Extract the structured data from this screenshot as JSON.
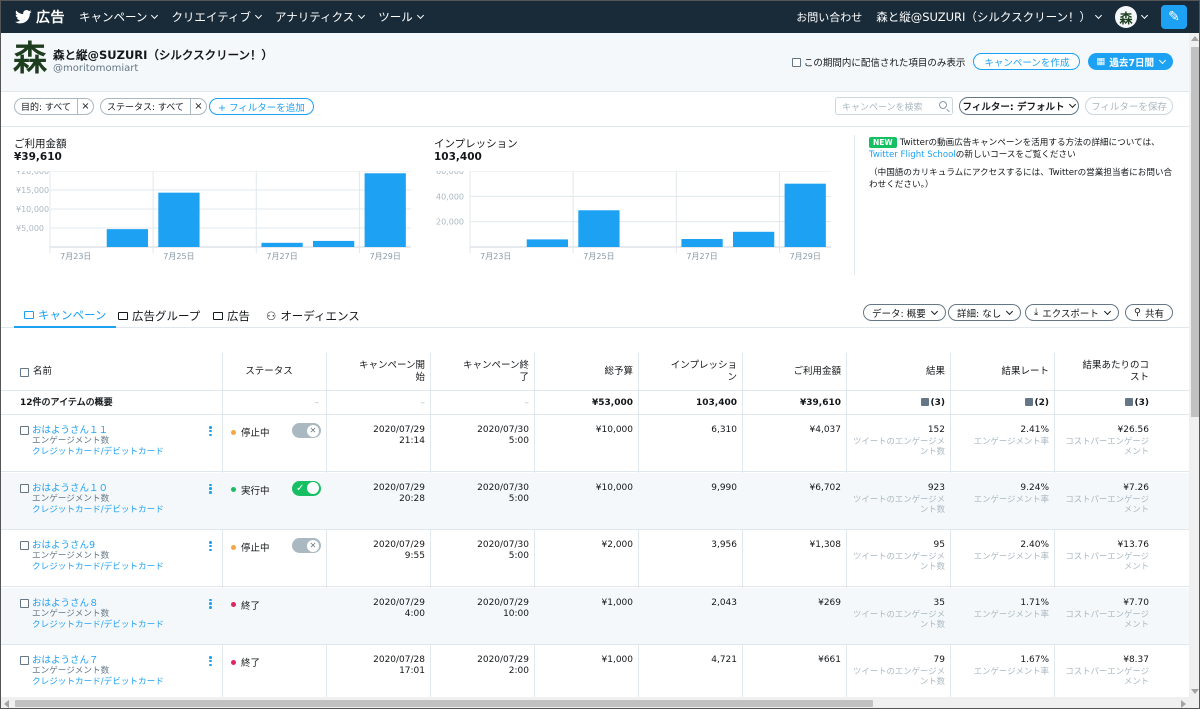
{
  "nav": {
    "brand": "広告",
    "menu": [
      "キャンペーン",
      "クリエイティブ",
      "アナリティクス",
      "ツール"
    ],
    "contact": "お問い合わせ",
    "account_menu": "森と縦@SUZURI（シルクスクリーン！）",
    "avatar_char": "森"
  },
  "account": {
    "logo_char": "森",
    "name": "森と縦@SUZURI（シルクスクリーン！）",
    "handle": "@moritomomiart",
    "only_delivered_label": "この期間内に配信された項目のみ表示",
    "create_campaign": "キャンペーンを作成",
    "date_range": "過去7日間"
  },
  "filters": {
    "chips": [
      "目的: すべて",
      "ステータス: すべて"
    ],
    "add_filter": "+ フィルターを追加",
    "search_placeholder": "キャンペーンを検索",
    "filter_default": "フィルター: デフォルト",
    "save_filter": "フィルターを保存"
  },
  "summary": {
    "spend_label": "ご利用金額",
    "spend_value": "¥39,610",
    "impressions_label": "インプレッション",
    "impressions_value": "103,400",
    "promo_badge": "NEW",
    "promo_text": "Twitterの動画広告キャンペーンを活用する方法の詳細については、",
    "promo_link": "Twitter Flight School",
    "promo_text_end": "の新しいコースをご覧ください",
    "promo_text2": "（中国語のカリキュラムにアクセスするには、Twitterの営業担当者にお問い合わせください。）"
  },
  "chart_data": [
    {
      "type": "bar",
      "title": "ご利用金額",
      "x": [
        "7月23日",
        "7月24日",
        "7月25日",
        "7月26日",
        "7月27日",
        "7月28日",
        "7月29日"
      ],
      "x_tick_labels": [
        "7月23日",
        "7月25日",
        "7月27日",
        "7月29日"
      ],
      "values": [
        0,
        4700,
        14300,
        0,
        1100,
        1600,
        19400
      ],
      "y_ticks": [
        "¥5,000",
        "¥10,000",
        "¥15,000",
        "¥20,000"
      ],
      "y_tick_values": [
        5000,
        10000,
        15000,
        20000
      ],
      "ylim": [
        0,
        20000
      ],
      "color": "#1da1f2",
      "grid": true
    },
    {
      "type": "bar",
      "title": "インプレッション",
      "x": [
        "7月23日",
        "7月24日",
        "7月25日",
        "7月26日",
        "7月27日",
        "7月28日",
        "7月29日"
      ],
      "x_tick_labels": [
        "7月23日",
        "7月25日",
        "7月27日",
        "7月29日"
      ],
      "values": [
        0,
        6000,
        29000,
        0,
        6300,
        12000,
        50000
      ],
      "y_ticks": [
        "20,000",
        "40,000",
        "60,000"
      ],
      "y_tick_values": [
        20000,
        40000,
        60000
      ],
      "ylim": [
        0,
        60000
      ],
      "color": "#1da1f2",
      "grid": true
    }
  ],
  "tabs": {
    "items": [
      "キャンペーン",
      "広告グループ",
      "広告",
      "オーディエンス"
    ],
    "data_btn": "データ: 概要",
    "detail_btn": "詳細: なし",
    "export_btn": "エクスポート",
    "share_btn": "共有"
  },
  "table": {
    "headers": {
      "name": "名前",
      "status": "ステータス",
      "start": "キャンペーン開始",
      "end": "キャンペーン終了",
      "budget": "総予算",
      "impressions": "インプレッション",
      "spend": "ご利用金額",
      "results": "結果",
      "result_rate": "結果レート",
      "cost_per_result": "結果あたりのコスト"
    },
    "summary": {
      "label": "12件のアイテムの概要",
      "status": "–",
      "start": "–",
      "end": "–",
      "budget": "¥53,000",
      "impressions": "103,400",
      "spend": "¥39,610",
      "results": "(3)",
      "result_rate": "(2)",
      "cost_per_result": "(3)"
    },
    "rows": [
      {
        "name": "おはようさん１１",
        "type": "エンゲージメント数",
        "payment": "クレジットカード/デビットカード",
        "status": "停止中",
        "status_color": "#f4a742",
        "toggle": "off",
        "start_date": "2020/07/29",
        "start_time": "21:14",
        "end_date": "2020/07/30",
        "end_time": "5:00",
        "budget": "¥10,000",
        "impressions": "6,310",
        "spend": "¥4,037",
        "results": "152",
        "results_sub": "ツイートのエンゲージメント数",
        "rate": "2.41%",
        "rate_sub": "エンゲージメント率",
        "cost": "¥26.56",
        "cost_sub": "コストパーエンゲージメント"
      },
      {
        "name": "おはようさん１０",
        "type": "エンゲージメント数",
        "payment": "クレジットカード/デビットカード",
        "status": "実行中",
        "status_color": "#17bf63",
        "toggle": "on",
        "start_date": "2020/07/29",
        "start_time": "20:28",
        "end_date": "2020/07/30",
        "end_time": "5:00",
        "budget": "¥10,000",
        "impressions": "9,990",
        "spend": "¥6,702",
        "results": "923",
        "results_sub": "ツイートのエンゲージメント数",
        "rate": "9.24%",
        "rate_sub": "エンゲージメント率",
        "cost": "¥7.26",
        "cost_sub": "コストパーエンゲージメント"
      },
      {
        "name": "おはようさん9",
        "type": "エンゲージメント数",
        "payment": "クレジットカード/デビットカード",
        "status": "停止中",
        "status_color": "#f4a742",
        "toggle": "off",
        "start_date": "2020/07/29",
        "start_time": "9:55",
        "end_date": "2020/07/30",
        "end_time": "5:00",
        "budget": "¥2,000",
        "impressions": "3,956",
        "spend": "¥1,308",
        "results": "95",
        "results_sub": "ツイートのエンゲージメント数",
        "rate": "2.40%",
        "rate_sub": "エンゲージメント率",
        "cost": "¥13.76",
        "cost_sub": "コストパーエンゲージメント"
      },
      {
        "name": "おはようさん８",
        "type": "エンゲージメント数",
        "payment": "クレジットカード/デビットカード",
        "status": "終了",
        "status_color": "#e0245e",
        "toggle": "none",
        "start_date": "2020/07/29",
        "start_time": "4:00",
        "end_date": "2020/07/29",
        "end_time": "10:00",
        "budget": "¥1,000",
        "impressions": "2,043",
        "spend": "¥269",
        "results": "35",
        "results_sub": "ツイートのエンゲージメント数",
        "rate": "1.71%",
        "rate_sub": "エンゲージメント率",
        "cost": "¥7.70",
        "cost_sub": "コストパーエンゲージメント"
      },
      {
        "name": "おはようさん７",
        "type": "エンゲージメント数",
        "payment": "クレジットカード/デビットカード",
        "status": "終了",
        "status_color": "#e0245e",
        "toggle": "none",
        "start_date": "2020/07/28",
        "start_time": "17:01",
        "end_date": "2020/07/29",
        "end_time": "2:00",
        "budget": "¥1,000",
        "impressions": "4,721",
        "spend": "¥661",
        "results": "79",
        "results_sub": "ツイートのエンゲージメント数",
        "rate": "1.67%",
        "rate_sub": "エンゲージメント率",
        "cost": "¥8.37",
        "cost_sub": "コストパーエンゲージメント"
      }
    ]
  }
}
